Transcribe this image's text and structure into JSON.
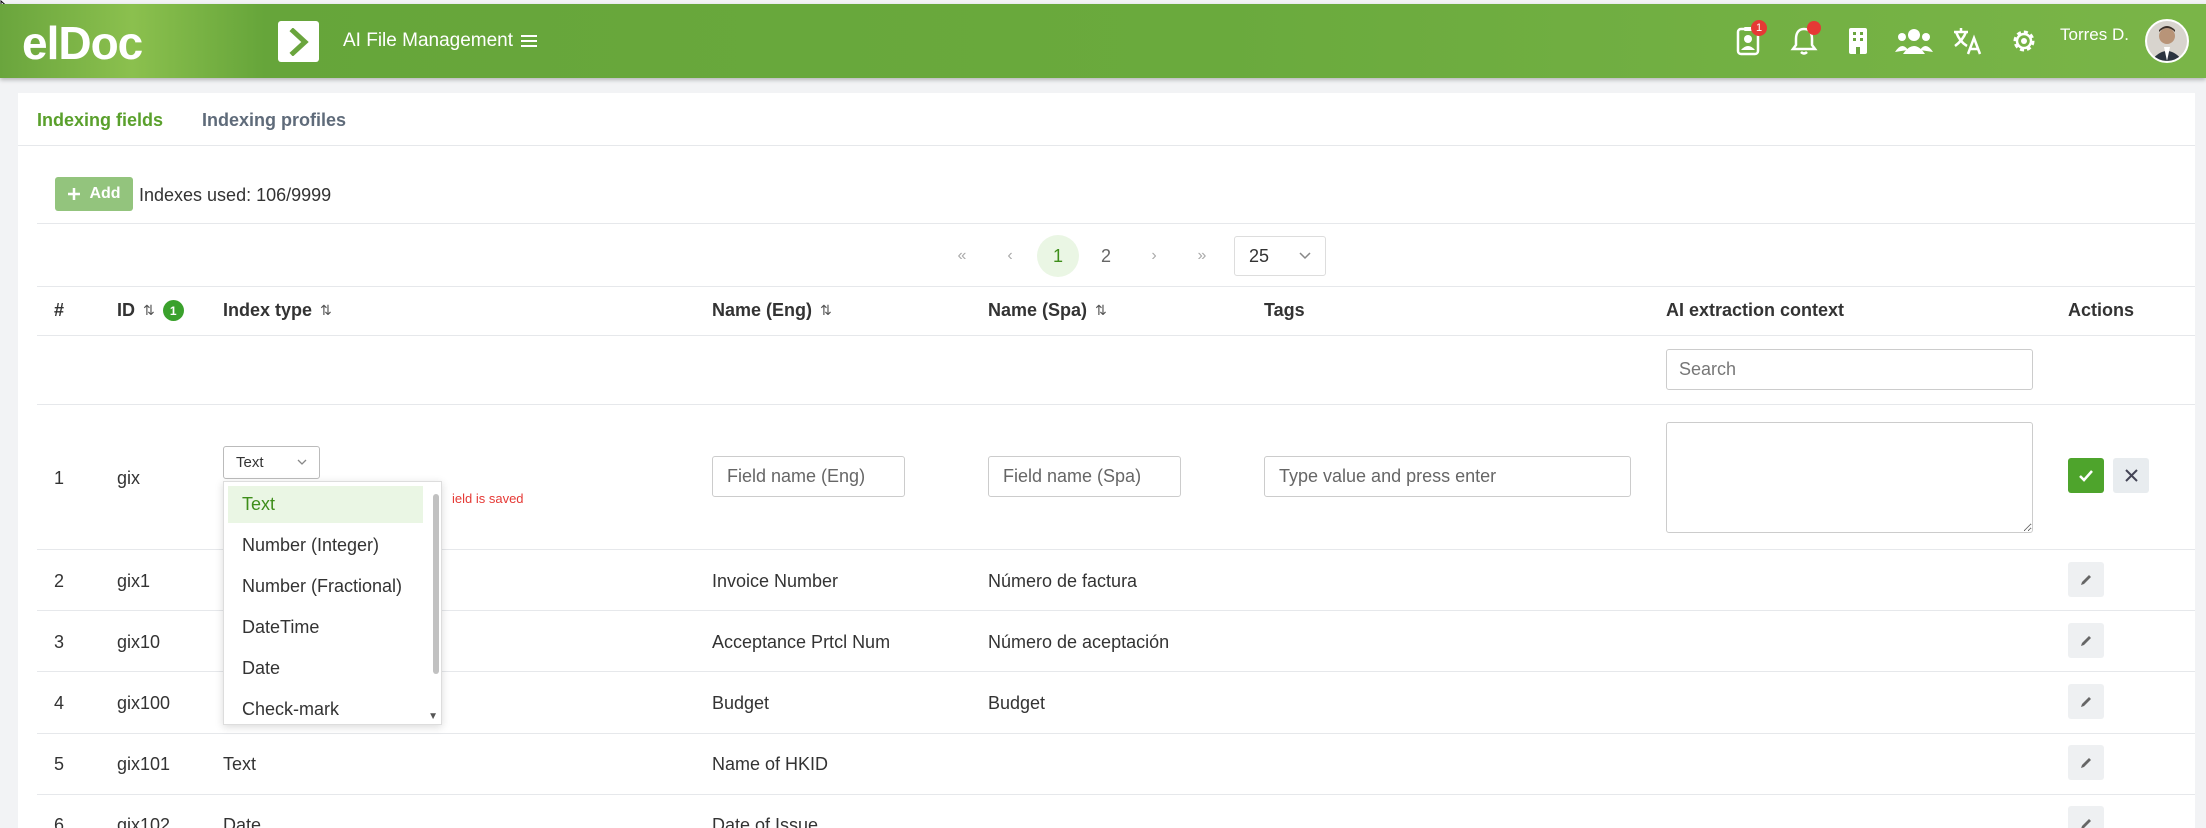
{
  "app": {
    "logo": "elDoc",
    "title": "AI File Management",
    "username": "Torres D.",
    "notifications": {
      "profile_badge": "1"
    }
  },
  "colors": {
    "accent": "#5aa02c",
    "topbar": "#6aa53d",
    "danger": "#e53935"
  },
  "tabs": [
    {
      "label": "Indexing fields",
      "active": true
    },
    {
      "label": "Indexing profiles",
      "active": false
    }
  ],
  "toolbar": {
    "add_label": "Add",
    "indexes_used": "Indexes used: 106/9999"
  },
  "pagination": {
    "first": "«",
    "prev": "‹",
    "pages": [
      "1",
      "2"
    ],
    "current": "1",
    "next": "›",
    "last": "»",
    "page_size": "25"
  },
  "table": {
    "columns": {
      "num": "#",
      "id": "ID",
      "id_sort_badge": "1",
      "index_type": "Index type",
      "name_eng": "Name (Eng)",
      "name_spa": "Name (Spa)",
      "tags": "Tags",
      "ai_context": "AI extraction context",
      "actions": "Actions"
    },
    "search_placeholder": "Search",
    "new_row": {
      "num": "1",
      "id": "gix",
      "type": "Text",
      "name_eng_placeholder": "Field name (Eng)",
      "name_spa_placeholder": "Field name (Spa)",
      "tags_placeholder": "Type value and press enter",
      "saved_note": "ield is saved"
    },
    "type_options": [
      "Text",
      "Number (Integer)",
      "Number (Fractional)",
      "DateTime",
      "Date",
      "Check-mark"
    ],
    "rows": [
      {
        "num": "2",
        "id": "gix1",
        "type": "",
        "name_eng": "Invoice Number",
        "name_spa": "Número de factura"
      },
      {
        "num": "3",
        "id": "gix10",
        "type": "",
        "name_eng": "Acceptance Prtcl Num",
        "name_spa": "Número de aceptación"
      },
      {
        "num": "4",
        "id": "gix100",
        "type": "",
        "name_eng": "Budget",
        "name_spa": "Budget"
      },
      {
        "num": "5",
        "id": "gix101",
        "type": "Text",
        "name_eng": "Name of HKID",
        "name_spa": ""
      },
      {
        "num": "6",
        "id": "gix102",
        "type": "Date",
        "name_eng": "Date of Issue",
        "name_spa": ""
      }
    ]
  }
}
